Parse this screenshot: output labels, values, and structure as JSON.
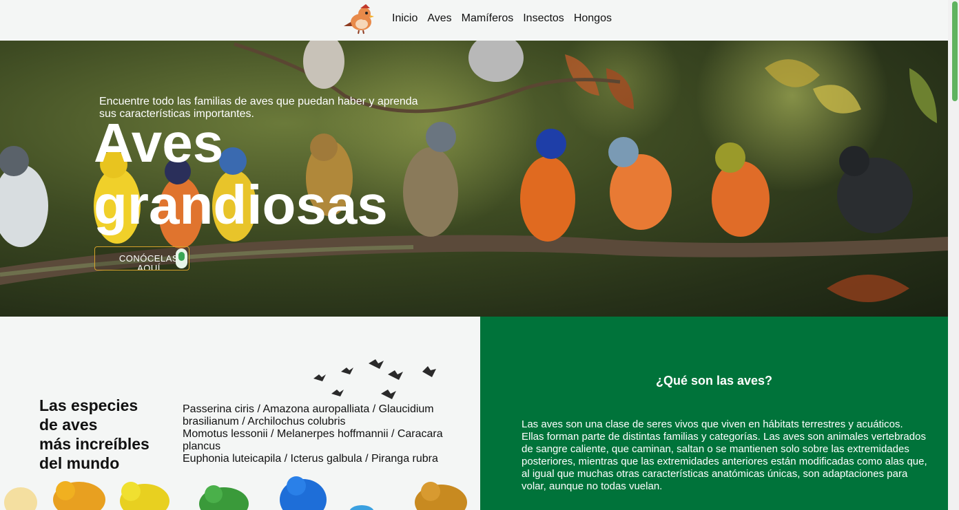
{
  "nav": {
    "logo_icon": "cartoon-bird-logo",
    "links": [
      "Inicio",
      "Aves",
      "Mamíferos",
      "Insectos",
      "Hongos"
    ]
  },
  "hero": {
    "subtitle": "Encuentre todo las familias de aves que puedan haber y aprenda sus características importantes.",
    "title_line1": "Aves",
    "title_line2": "grandiosas",
    "button_label": "CONÓCELAS AQUÍ"
  },
  "species": {
    "title_lines": [
      "Las especies",
      "de aves",
      "más increíbles",
      "del mundo"
    ],
    "list_lines": [
      "Passerina ciris / Amazona auropalliata / Glaucidium brasilianum / Archilochus colubris",
      "Momotus lessonii / Melanerpes hoffmannii / Caracara plancus",
      "Euphonia luteicapila / Icterus galbula / Piranga rubra"
    ]
  },
  "about": {
    "title": "¿Qué son las aves?",
    "text": "Las aves son una clase de seres vivos que viven en hábitats terrestres y acuáticos. Ellas forman parte de distintas familias y categorías. Las aves son animales vertebrados de sangre caliente, que caminan, saltan o se mantienen solo sobre las extremidades posteriores, mientras que las extremidades anteriores están modificadas como alas que, al igual que muchas otras características anatómicas únicas, son adaptaciones para volar, aunque no todas vuelan."
  },
  "colors": {
    "nav_bg": "#f4f6f5",
    "accent_green": "#00733a",
    "button_border": "#d4a12a",
    "scroll_thumb": "#5fb35f"
  }
}
